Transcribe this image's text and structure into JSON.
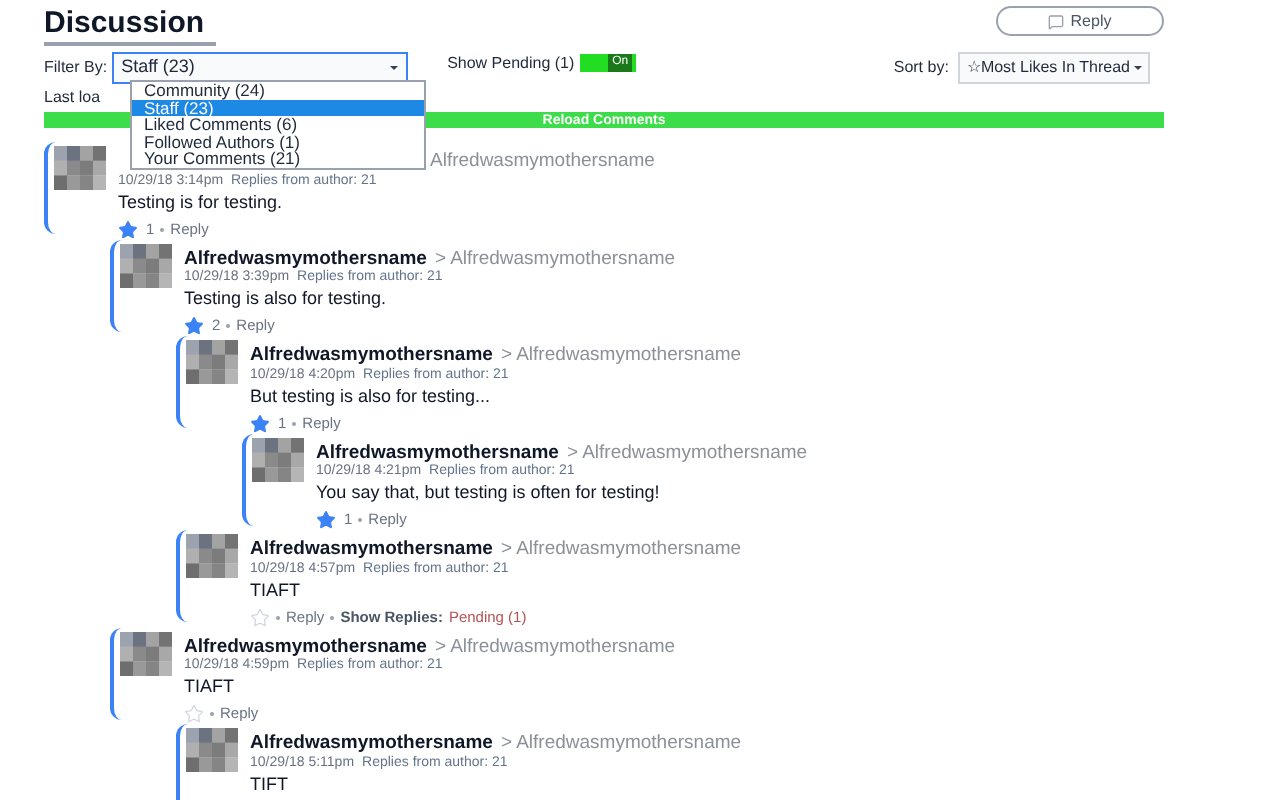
{
  "header": {
    "title": "Discussion",
    "reply_button": "Reply"
  },
  "filter": {
    "label": "Filter By:",
    "value": "Staff (23)",
    "expanded": true,
    "options": [
      {
        "label": "Community (24)",
        "selected": false
      },
      {
        "label": "Staff (23)",
        "selected": true
      },
      {
        "label": "Liked Comments (6)",
        "selected": false
      },
      {
        "label": "Followed Authors (1)",
        "selected": false
      },
      {
        "label": "Your Comments (21)",
        "selected": false
      }
    ]
  },
  "pending": {
    "label": "Show Pending (1)",
    "on": true,
    "toggle_text": "On"
  },
  "sort": {
    "label": "Sort by:",
    "value": "☆Most Likes In Thread"
  },
  "last_loaded": "Last loa",
  "reload_button": "Reload Comments",
  "comments": [
    {
      "reply_to": "Alfredwasmymothersname",
      "date": "10/29/18 3:14pm",
      "replies_from": "Replies from author: 21",
      "text": "Testing is for testing.",
      "liked": true,
      "likes": "1",
      "reply": "Reply",
      "children": [
        {
          "author": "Alfredwasmymothersname",
          "reply_to": "> Alfredwasmymothersname",
          "date": "10/29/18 3:39pm",
          "replies_from": "Replies from author: 21",
          "text": "Testing is also for testing.",
          "liked": true,
          "likes": "2",
          "reply": "Reply",
          "children": [
            {
              "author": "Alfredwasmymothersname",
              "reply_to": "> Alfredwasmymothersname",
              "date": "10/29/18 4:20pm",
              "replies_from": "Replies from author: 21",
              "text": "But testing is also for testing...",
              "liked": true,
              "likes": "1",
              "reply": "Reply",
              "children": [
                {
                  "author": "Alfredwasmymothersname",
                  "reply_to": "> Alfredwasmymothersname",
                  "date": "10/29/18 4:21pm",
                  "replies_from": "Replies from author: 21",
                  "text": "You say that, but testing is often for testing!",
                  "liked": true,
                  "likes": "1",
                  "reply": "Reply"
                }
              ]
            },
            {
              "author": "Alfredwasmymothersname",
              "reply_to": "> Alfredwasmymothersname",
              "date": "10/29/18 4:57pm",
              "replies_from": "Replies from author: 21",
              "text": "TIAFT",
              "liked": false,
              "reply": "Reply",
              "show_replies": {
                "label": "Show Replies:",
                "value": "Pending (1)"
              }
            }
          ]
        },
        {
          "author": "Alfredwasmymothersname",
          "reply_to": "> Alfredwasmymothersname",
          "date": "10/29/18 4:59pm",
          "replies_from": "Replies from author: 21",
          "text": "TIAFT",
          "liked": false,
          "reply": "Reply",
          "children": [
            {
              "author": "Alfredwasmymothersname",
              "reply_to": "> Alfredwasmymothersname",
              "date": "10/29/18 5:11pm",
              "replies_from": "Replies from author: 21",
              "text": "TIFT"
            }
          ]
        }
      ]
    }
  ]
}
